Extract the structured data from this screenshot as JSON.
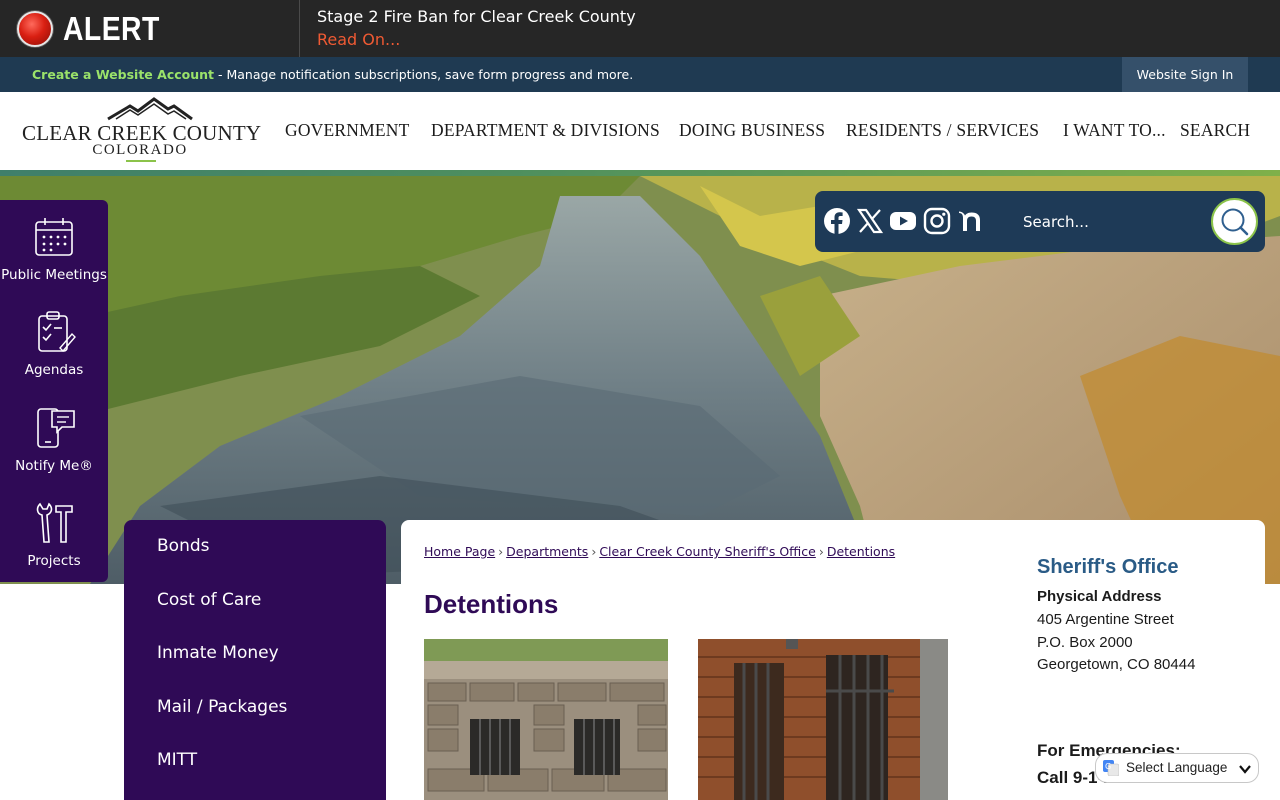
{
  "alert": {
    "label": "ALERT",
    "title": "Stage 2 Fire Ban for Clear Creek County",
    "link": "Read On..."
  },
  "account_bar": {
    "create_link": "Create a Website Account",
    "message": " - Manage notification subscriptions, save form progress and more.",
    "sign_in": "Website Sign In"
  },
  "logo": {
    "line1": "CLEAR CREEK COUNTY",
    "line2": "COLORADO"
  },
  "nav": [
    "GOVERNMENT",
    "DEPARTMENT & DIVISIONS",
    "DOING BUSINESS",
    "RESIDENTS / SERVICES",
    "I WANT TO...",
    "SEARCH"
  ],
  "quick_links": [
    {
      "label": "Public Meetings",
      "icon": "calendar-icon"
    },
    {
      "label": "Agendas",
      "icon": "clipboard-icon"
    },
    {
      "label": "Notify Me®",
      "icon": "phone-message-icon"
    },
    {
      "label": "Projects",
      "icon": "tools-icon"
    }
  ],
  "social": [
    "facebook-icon",
    "x-icon",
    "youtube-icon",
    "instagram-icon",
    "nextdoor-icon"
  ],
  "search": {
    "placeholder": "Search..."
  },
  "side_menu": [
    "Bonds",
    "Cost of Care",
    "Inmate Money",
    "Mail / Packages",
    "MITT"
  ],
  "breadcrumb": [
    "Home Page",
    "Departments",
    "Clear Creek County Sheriff's Office",
    "Detentions"
  ],
  "page_title": "Detentions",
  "contact": {
    "title": "Sheriff's Office",
    "physical_label": "Physical Address",
    "lines": [
      "405 Argentine Street",
      "P.O. Box 2000",
      "Georgetown, CO 80444"
    ],
    "emergency_label": "For Emergencies:",
    "emergency_call": "Call 9-1-1"
  },
  "translate": {
    "label": "Select Language"
  },
  "colors": {
    "alert_bg": "#262626",
    "alert_link": "#ef5a33",
    "account_bar": "#1f3a52",
    "account_link": "#9be36a",
    "brand_purple": "#2f0a56",
    "social_panel": "#1e3a57",
    "contact_title": "#2a5b86"
  }
}
